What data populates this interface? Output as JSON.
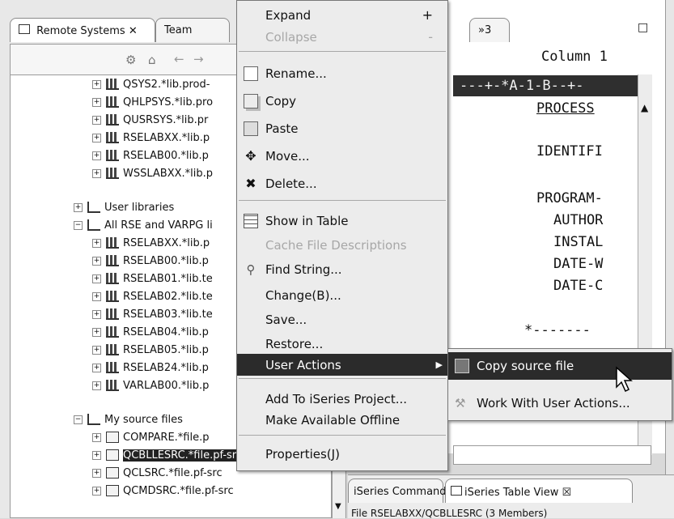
{
  "left_panel": {
    "tabs": [
      {
        "label": "Remote Systems ✕",
        "active": true
      },
      {
        "label": "Team",
        "active": false
      }
    ],
    "tree": [
      {
        "label": "QSYS2.*lib.prod-",
        "kind": "lib",
        "level": 2
      },
      {
        "label": "QHLPSYS.*lib.pro",
        "kind": "lib",
        "level": 2
      },
      {
        "label": "QUSRSYS.*lib.pr",
        "kind": "lib",
        "level": 2
      },
      {
        "label": "RSELABXX.*lib.p",
        "kind": "lib",
        "level": 2
      },
      {
        "label": "RSELAB00.*lib.p",
        "kind": "lib",
        "level": 2
      },
      {
        "label": "WSSLABXX.*lib.p",
        "kind": "lib",
        "level": 2
      },
      {
        "label": "User libraries",
        "kind": "filter",
        "level": 1,
        "state": "+"
      },
      {
        "label": "All RSE and VARPG li",
        "kind": "filter",
        "level": 1,
        "state": "−"
      },
      {
        "label": "RSELABXX.*lib.p",
        "kind": "lib",
        "level": 2
      },
      {
        "label": "RSELAB00.*lib.p",
        "kind": "lib",
        "level": 2
      },
      {
        "label": "RSELAB01.*lib.te",
        "kind": "lib",
        "level": 2
      },
      {
        "label": "RSELAB02.*lib.te",
        "kind": "lib",
        "level": 2
      },
      {
        "label": "RSELAB03.*lib.te",
        "kind": "lib",
        "level": 2
      },
      {
        "label": "RSELAB04.*lib.p",
        "kind": "lib",
        "level": 2
      },
      {
        "label": "RSELAB05.*lib.p",
        "kind": "lib",
        "level": 2
      },
      {
        "label": "RSELAB24.*lib.p",
        "kind": "lib",
        "level": 2
      },
      {
        "label": "VARLAB00.*lib.p",
        "kind": "lib",
        "level": 2
      },
      {
        "label": "My source files",
        "kind": "filter",
        "level": 1,
        "state": "−"
      },
      {
        "label": "COMPARE.*file.p",
        "kind": "file",
        "level": 2
      },
      {
        "label": "QCBLLESRC.*file.pf-src",
        "kind": "file",
        "level": 2,
        "selected": true
      },
      {
        "label": "QCLSRC.*file.pf-src",
        "kind": "file",
        "level": 2
      },
      {
        "label": "QCMDSRC.*file.pf-src",
        "kind": "file",
        "level": 2
      }
    ]
  },
  "editor": {
    "tab_overflow": "»3",
    "column_label": "Column 1",
    "ruler": "---+-*A-1-B--+-",
    "lines": [
      "PROCESS",
      "IDENTIFI",
      "PROGRAM-",
      "AUTHOR",
      "INSTAL",
      "DATE-W",
      "DATE-C",
      "*-------"
    ]
  },
  "bottom": {
    "tabs": [
      {
        "label": "iSeries Command...",
        "active": false
      },
      {
        "label": "iSeries Table View ☒",
        "active": true
      }
    ],
    "status": "File RSELABXX/QCBLLESRC (3 Members)"
  },
  "context_menu": {
    "items": [
      {
        "label": "Expand",
        "shortcut": "+",
        "enabled": true
      },
      {
        "label": "Collapse",
        "shortcut": "-",
        "enabled": false
      },
      {
        "separator": true
      },
      {
        "label": "Rename...",
        "icon": "rename-icon",
        "enabled": true
      },
      {
        "label": "Copy",
        "icon": "copy-icon",
        "enabled": true
      },
      {
        "label": "Paste",
        "icon": "paste-icon",
        "enabled": true
      },
      {
        "label": "Move...",
        "icon": "move-icon",
        "enabled": true
      },
      {
        "label": "Delete...",
        "icon": "delete-icon",
        "enabled": true
      },
      {
        "separator": true
      },
      {
        "label": "Show in Table",
        "icon": "table-icon",
        "enabled": true
      },
      {
        "label": "Cache File Descriptions",
        "enabled": false
      },
      {
        "label": "Find String...",
        "icon": "find-icon",
        "enabled": true
      },
      {
        "label": "Change(B)...",
        "enabled": true
      },
      {
        "label": "Save...",
        "enabled": true
      },
      {
        "label": "Restore...",
        "enabled": true
      },
      {
        "label": "User Actions",
        "enabled": true,
        "highlighted": true,
        "submenu": true
      },
      {
        "separator": true
      },
      {
        "label": "Add To iSeries Project...",
        "enabled": true
      },
      {
        "label": "Make Available Offline",
        "enabled": true
      },
      {
        "separator": true
      },
      {
        "label": "Properties(J)",
        "enabled": true
      }
    ]
  },
  "submenu": {
    "items": [
      {
        "label": "Copy source file",
        "highlighted": true,
        "icon": "copy-source-icon"
      },
      {
        "label": "Work With User Actions...",
        "highlighted": false,
        "icon": "user-actions-icon"
      }
    ]
  }
}
